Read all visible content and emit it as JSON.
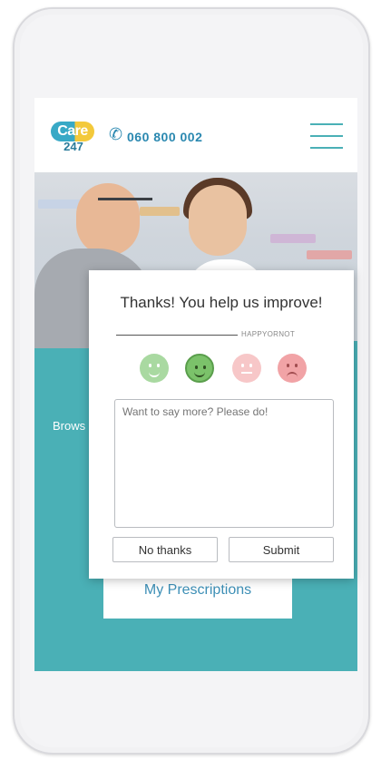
{
  "header": {
    "logo_top": "Care",
    "logo_bottom": "247",
    "phone_number": "060 800 002",
    "menu_icon": "hamburger-menu-icon"
  },
  "page": {
    "browse_label": "Brows",
    "my_prescriptions_label": "My Prescriptions"
  },
  "feedback": {
    "title_prefix": "Thanks!",
    "title_bold": "You help us improve!",
    "brand": "HAPPYORNOT",
    "ratings": [
      {
        "name": "very-happy",
        "color": "#a9d9a1"
      },
      {
        "name": "happy",
        "color": "#7bc26a",
        "selected": true
      },
      {
        "name": "unhappy",
        "color": "#f7c7c8"
      },
      {
        "name": "very-unhappy",
        "color": "#f1a3a6"
      }
    ],
    "comment_placeholder": "Want to say more? Please do!",
    "no_thanks_label": "No thanks",
    "submit_label": "Submit"
  },
  "colors": {
    "accent_teal": "#4ab0b6",
    "brand_blue": "#2a88b0",
    "logo_yellow": "#f3c93b"
  }
}
